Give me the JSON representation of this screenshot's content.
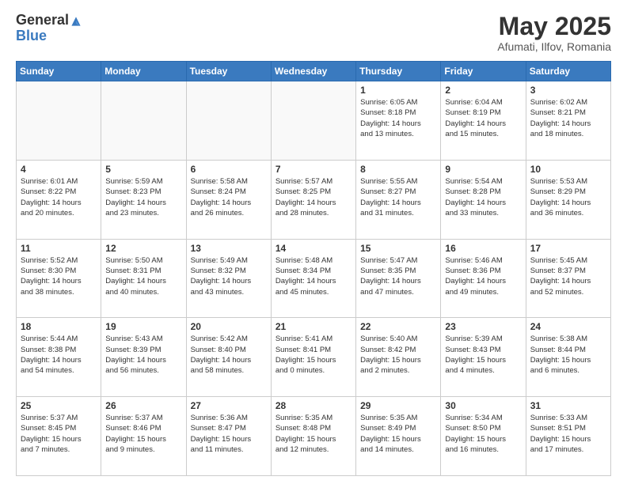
{
  "header": {
    "logo_general": "General",
    "logo_blue": "Blue",
    "month_title": "May 2025",
    "subtitle": "Afumati, Ilfov, Romania"
  },
  "days_of_week": [
    "Sunday",
    "Monday",
    "Tuesday",
    "Wednesday",
    "Thursday",
    "Friday",
    "Saturday"
  ],
  "weeks": [
    [
      {
        "day": "",
        "info": ""
      },
      {
        "day": "",
        "info": ""
      },
      {
        "day": "",
        "info": ""
      },
      {
        "day": "",
        "info": ""
      },
      {
        "day": "1",
        "info": "Sunrise: 6:05 AM\nSunset: 8:18 PM\nDaylight: 14 hours\nand 13 minutes."
      },
      {
        "day": "2",
        "info": "Sunrise: 6:04 AM\nSunset: 8:19 PM\nDaylight: 14 hours\nand 15 minutes."
      },
      {
        "day": "3",
        "info": "Sunrise: 6:02 AM\nSunset: 8:21 PM\nDaylight: 14 hours\nand 18 minutes."
      }
    ],
    [
      {
        "day": "4",
        "info": "Sunrise: 6:01 AM\nSunset: 8:22 PM\nDaylight: 14 hours\nand 20 minutes."
      },
      {
        "day": "5",
        "info": "Sunrise: 5:59 AM\nSunset: 8:23 PM\nDaylight: 14 hours\nand 23 minutes."
      },
      {
        "day": "6",
        "info": "Sunrise: 5:58 AM\nSunset: 8:24 PM\nDaylight: 14 hours\nand 26 minutes."
      },
      {
        "day": "7",
        "info": "Sunrise: 5:57 AM\nSunset: 8:25 PM\nDaylight: 14 hours\nand 28 minutes."
      },
      {
        "day": "8",
        "info": "Sunrise: 5:55 AM\nSunset: 8:27 PM\nDaylight: 14 hours\nand 31 minutes."
      },
      {
        "day": "9",
        "info": "Sunrise: 5:54 AM\nSunset: 8:28 PM\nDaylight: 14 hours\nand 33 minutes."
      },
      {
        "day": "10",
        "info": "Sunrise: 5:53 AM\nSunset: 8:29 PM\nDaylight: 14 hours\nand 36 minutes."
      }
    ],
    [
      {
        "day": "11",
        "info": "Sunrise: 5:52 AM\nSunset: 8:30 PM\nDaylight: 14 hours\nand 38 minutes."
      },
      {
        "day": "12",
        "info": "Sunrise: 5:50 AM\nSunset: 8:31 PM\nDaylight: 14 hours\nand 40 minutes."
      },
      {
        "day": "13",
        "info": "Sunrise: 5:49 AM\nSunset: 8:32 PM\nDaylight: 14 hours\nand 43 minutes."
      },
      {
        "day": "14",
        "info": "Sunrise: 5:48 AM\nSunset: 8:34 PM\nDaylight: 14 hours\nand 45 minutes."
      },
      {
        "day": "15",
        "info": "Sunrise: 5:47 AM\nSunset: 8:35 PM\nDaylight: 14 hours\nand 47 minutes."
      },
      {
        "day": "16",
        "info": "Sunrise: 5:46 AM\nSunset: 8:36 PM\nDaylight: 14 hours\nand 49 minutes."
      },
      {
        "day": "17",
        "info": "Sunrise: 5:45 AM\nSunset: 8:37 PM\nDaylight: 14 hours\nand 52 minutes."
      }
    ],
    [
      {
        "day": "18",
        "info": "Sunrise: 5:44 AM\nSunset: 8:38 PM\nDaylight: 14 hours\nand 54 minutes."
      },
      {
        "day": "19",
        "info": "Sunrise: 5:43 AM\nSunset: 8:39 PM\nDaylight: 14 hours\nand 56 minutes."
      },
      {
        "day": "20",
        "info": "Sunrise: 5:42 AM\nSunset: 8:40 PM\nDaylight: 14 hours\nand 58 minutes."
      },
      {
        "day": "21",
        "info": "Sunrise: 5:41 AM\nSunset: 8:41 PM\nDaylight: 15 hours\nand 0 minutes."
      },
      {
        "day": "22",
        "info": "Sunrise: 5:40 AM\nSunset: 8:42 PM\nDaylight: 15 hours\nand 2 minutes."
      },
      {
        "day": "23",
        "info": "Sunrise: 5:39 AM\nSunset: 8:43 PM\nDaylight: 15 hours\nand 4 minutes."
      },
      {
        "day": "24",
        "info": "Sunrise: 5:38 AM\nSunset: 8:44 PM\nDaylight: 15 hours\nand 6 minutes."
      }
    ],
    [
      {
        "day": "25",
        "info": "Sunrise: 5:37 AM\nSunset: 8:45 PM\nDaylight: 15 hours\nand 7 minutes."
      },
      {
        "day": "26",
        "info": "Sunrise: 5:37 AM\nSunset: 8:46 PM\nDaylight: 15 hours\nand 9 minutes."
      },
      {
        "day": "27",
        "info": "Sunrise: 5:36 AM\nSunset: 8:47 PM\nDaylight: 15 hours\nand 11 minutes."
      },
      {
        "day": "28",
        "info": "Sunrise: 5:35 AM\nSunset: 8:48 PM\nDaylight: 15 hours\nand 12 minutes."
      },
      {
        "day": "29",
        "info": "Sunrise: 5:35 AM\nSunset: 8:49 PM\nDaylight: 15 hours\nand 14 minutes."
      },
      {
        "day": "30",
        "info": "Sunrise: 5:34 AM\nSunset: 8:50 PM\nDaylight: 15 hours\nand 16 minutes."
      },
      {
        "day": "31",
        "info": "Sunrise: 5:33 AM\nSunset: 8:51 PM\nDaylight: 15 hours\nand 17 minutes."
      }
    ]
  ]
}
